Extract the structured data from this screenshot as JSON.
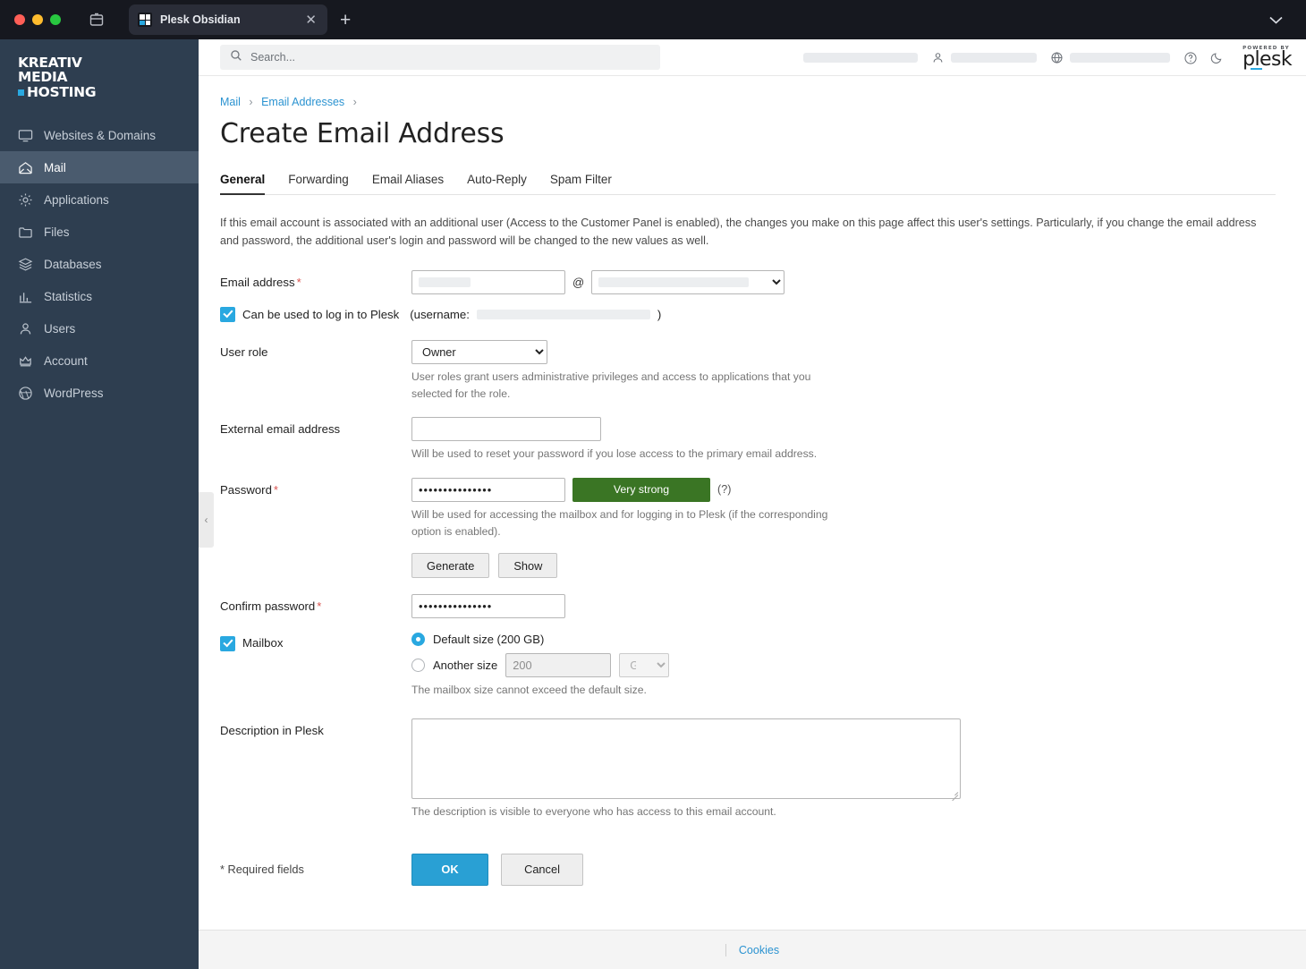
{
  "browser": {
    "tab_title": "Plesk Obsidian",
    "close_label": "✕",
    "new_tab_label": "+",
    "window_chevron": "⌄"
  },
  "sidebar": {
    "logo": {
      "line1": "KREATIV",
      "line2": "MEDIA",
      "line3": "HOSTING"
    },
    "items": [
      {
        "label": "Websites & Domains",
        "icon": "monitor-icon"
      },
      {
        "label": "Mail",
        "icon": "mail-icon"
      },
      {
        "label": "Applications",
        "icon": "gear-icon"
      },
      {
        "label": "Files",
        "icon": "folder-icon"
      },
      {
        "label": "Databases",
        "icon": "database-icon"
      },
      {
        "label": "Statistics",
        "icon": "chart-icon"
      },
      {
        "label": "Users",
        "icon": "user-icon"
      },
      {
        "label": "Account",
        "icon": "crown-icon"
      },
      {
        "label": "WordPress",
        "icon": "wordpress-icon"
      }
    ],
    "collapse_chevron": "‹"
  },
  "topbar": {
    "search_placeholder": "Search...",
    "help_icon_label": "?",
    "plesk_powered_by": "POWERED BY",
    "plesk_word": "plesk"
  },
  "breadcrumb": {
    "item1": "Mail",
    "item2": "Email Addresses",
    "sep": "›"
  },
  "page": {
    "title": "Create Email Address",
    "tabs": [
      {
        "label": "General",
        "active": true
      },
      {
        "label": "Forwarding",
        "active": false
      },
      {
        "label": "Email Aliases",
        "active": false
      },
      {
        "label": "Auto-Reply",
        "active": false
      },
      {
        "label": "Spam Filter",
        "active": false
      }
    ],
    "intro": "If this email account is associated with an additional user (Access to the Customer Panel is enabled), the changes you make on this page affect this user's settings. Particularly, if you change the email address and password, the additional user's login and password will be changed to the new values as well."
  },
  "form": {
    "email_label": "Email address",
    "at_symbol": "@",
    "login_checkbox_label": "Can be used to log in to Plesk",
    "username_prefix": "(username:",
    "username_suffix": ")",
    "user_role_label": "User role",
    "user_role_value": "Owner",
    "user_role_hint": "User roles grant users administrative privileges and access to applications that you selected for the role.",
    "external_email_label": "External email address",
    "external_email_value": "",
    "external_email_hint": "Will be used to reset your password if you lose access to the primary email address.",
    "password_label": "Password",
    "password_value": "•••••••••••••••",
    "password_strength": "Very strong",
    "password_help": "(?)",
    "password_hint": "Will be used for accessing the mailbox and for logging in to Plesk (if the corresponding option is enabled).",
    "generate_label": "Generate",
    "show_label": "Show",
    "confirm_password_label": "Confirm password",
    "confirm_password_value": "•••••••••••••••",
    "mailbox_label": "Mailbox",
    "default_size_label": "Default size (200 GB)",
    "another_size_label": "Another size",
    "another_size_value": "200",
    "size_unit_value": "GB",
    "mailbox_hint": "The mailbox size cannot exceed the default size.",
    "description_label": "Description in Plesk",
    "description_value": "",
    "description_hint": "The description is visible to everyone who has access to this email account.",
    "required_note": "* Required fields",
    "ok_label": "OK",
    "cancel_label": "Cancel"
  },
  "footer": {
    "cookies_label": "Cookies"
  },
  "colors": {
    "sidebar_bg": "#2E3E50",
    "sidebar_active": "#4A5B6E",
    "accent_blue": "#29A8E0",
    "link_blue": "#2B93D1",
    "strength_green": "#3A7524",
    "required_red": "#D9534F"
  }
}
